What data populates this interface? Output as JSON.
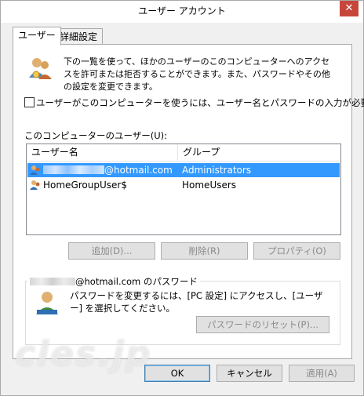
{
  "window": {
    "title": "ユーザー アカウント",
    "close_glyph": "✕"
  },
  "tabs": [
    {
      "label": "ユーザー",
      "active": true
    },
    {
      "label": "詳細設定",
      "active": false
    }
  ],
  "intro": {
    "text": "下の一覧を使って、ほかのユーザーのこのコンピューターへのアクセスを許可または拒否することができます。また、パスワードやその他の設定を変更できます。"
  },
  "require_login": {
    "label": "ユーザーがこのコンピューターを使うには、ユーザー名とパスワードの入力が必要(E)",
    "checked": false
  },
  "users_list": {
    "label": "このコンピューターのユーザー(U):",
    "columns": [
      "ユーザー名",
      "グループ"
    ],
    "rows": [
      {
        "name": "@hotmail.com",
        "group": "Administrators",
        "selected": true
      },
      {
        "name": "HomeGroupUser$",
        "group": "HomeUsers",
        "selected": false
      }
    ]
  },
  "list_buttons": {
    "add": "追加(D)...",
    "remove": "削除(R)",
    "properties": "プロパティ(O)"
  },
  "password_group": {
    "title_suffix": "@hotmail.com のパスワード",
    "text": "パスワードを変更するには、[PC 設定] にアクセスし、[ユーザー] を選択してください。",
    "reset_button": "パスワードのリセット(P)..."
  },
  "dialog_buttons": {
    "ok": "OK",
    "cancel": "キャンセル",
    "apply": "適用(A)"
  },
  "watermark": "cles.jp",
  "colors": {
    "selection": "#3399ff",
    "close": "#c7463b"
  }
}
